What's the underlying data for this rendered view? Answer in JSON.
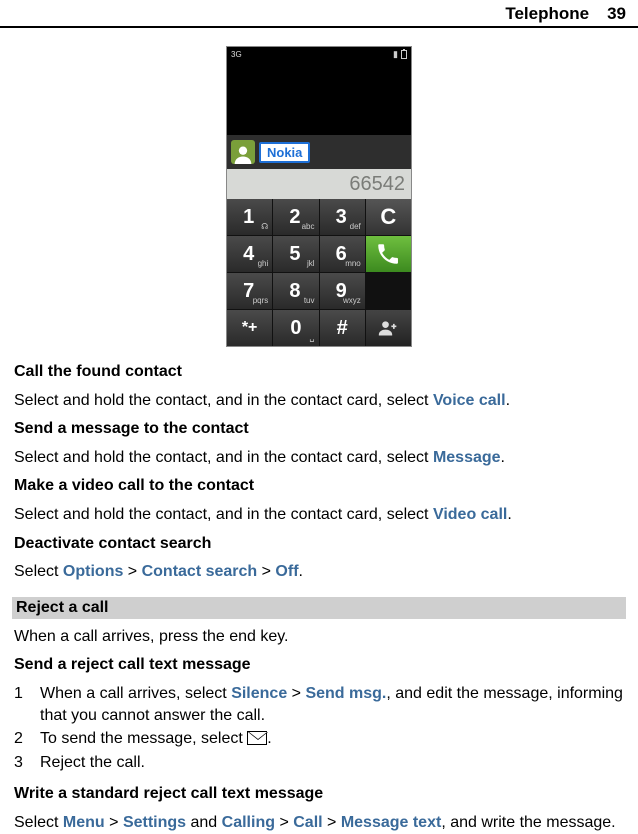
{
  "header": {
    "section": "Telephone",
    "page": "39"
  },
  "phone": {
    "status_net": "3G",
    "contact_name": "Nokia",
    "dialed_number": "66542",
    "keys": {
      "k1": {
        "d": "1",
        "s": ""
      },
      "k2": {
        "d": "2",
        "s": "abc"
      },
      "k3": {
        "d": "3",
        "s": "def"
      },
      "k4": {
        "d": "4",
        "s": "ghi"
      },
      "k5": {
        "d": "5",
        "s": "jkl"
      },
      "k6": {
        "d": "6",
        "s": "mno"
      },
      "k7": {
        "d": "7",
        "s": "pqrs"
      },
      "k8": {
        "d": "8",
        "s": "tuv"
      },
      "k9": {
        "d": "9",
        "s": "wxyz"
      },
      "kstar": {
        "d": "*+",
        "s": ""
      },
      "k0": {
        "d": "0",
        "s": ""
      },
      "khash": {
        "d": "#",
        "s": ""
      },
      "kclear": "C"
    }
  },
  "sec1": {
    "h": "Call the found contact",
    "t1": "Select and hold the contact, and in the contact card, select ",
    "u1": "Voice call",
    "t2": "."
  },
  "sec2": {
    "h": "Send a message to the contact",
    "t1": "Select and hold the contact, and in the contact card, select ",
    "u1": "Message",
    "t2": "."
  },
  "sec3": {
    "h": "Make a video call to the contact",
    "t1": "Select and hold the contact, and in the contact card, select ",
    "u1": "Video call",
    "t2": "."
  },
  "sec4": {
    "h": "Deactivate contact search",
    "t1": "Select ",
    "u1": "Options",
    "t2": " > ",
    "u2": "Contact search",
    "t3": " > ",
    "u3": "Off",
    "t4": "."
  },
  "bar1": "Reject a call",
  "reject_intro": "When a call arrives, press the end key.",
  "sec5": {
    "h": "Send a reject call text message",
    "s1a": "When a call arrives, select ",
    "s1u1": "Silence",
    "s1b": " > ",
    "s1u2": "Send msg.",
    "s1c": ", and edit the message, informing that you cannot answer the call.",
    "s2a": "To send the message, select ",
    "s2b": ".",
    "s3": "Reject the call."
  },
  "sec6": {
    "h": "Write a standard reject call text message",
    "t1": "Select ",
    "u1": "Menu",
    "t2": " > ",
    "u2": "Settings",
    "t3": " and ",
    "u3": "Calling",
    "t4": " > ",
    "u4": "Call",
    "t5": " > ",
    "u5": "Message text",
    "t6": ", and write the message."
  },
  "nums": {
    "n1": "1",
    "n2": "2",
    "n3": "3"
  }
}
